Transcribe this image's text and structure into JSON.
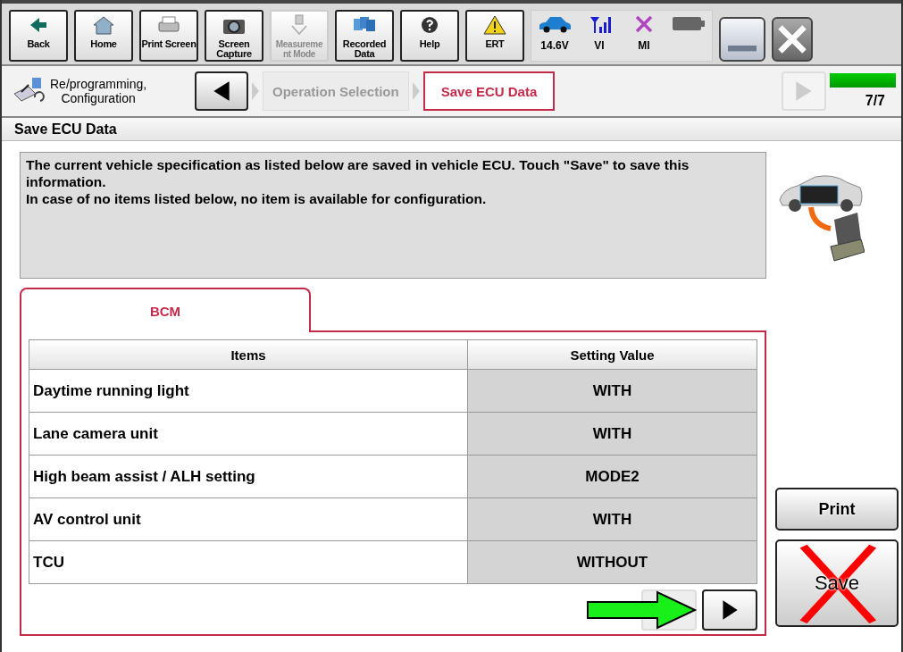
{
  "toolbar": {
    "buttons": [
      {
        "kind": "back",
        "lines": [
          "Back"
        ],
        "disabled": false
      },
      {
        "kind": "home",
        "lines": [
          "Home"
        ],
        "disabled": false
      },
      {
        "kind": "printer",
        "lines": [
          "Print Screen"
        ],
        "disabled": false
      },
      {
        "kind": "camera",
        "lines": [
          "Screen",
          "Capture"
        ],
        "disabled": false
      },
      {
        "kind": "meter",
        "lines": [
          "Measureme",
          "nt Mode"
        ],
        "disabled": true
      },
      {
        "kind": "folders",
        "lines": [
          "Recorded",
          "Data"
        ],
        "disabled": false
      },
      {
        "kind": "help",
        "lines": [
          "Help"
        ],
        "disabled": false
      },
      {
        "kind": "warning",
        "lines": [
          "ERT"
        ],
        "disabled": false
      }
    ],
    "status": [
      {
        "kind": "car",
        "label": "14.6V"
      },
      {
        "kind": "signal",
        "label": "VI"
      },
      {
        "kind": "cross",
        "label": "MI"
      },
      {
        "kind": "battery"
      }
    ]
  },
  "breadcrumb": {
    "title_lines": [
      "Re/programming,",
      "Configuration"
    ],
    "steps": [
      {
        "label": "Operation Selection",
        "selected": false
      },
      {
        "label": "Save ECU Data",
        "selected": true
      }
    ],
    "progress": {
      "level": 1,
      "label": "7/7"
    }
  },
  "section_title": "Save ECU Data",
  "info_lines": [
    "The current vehicle specification as listed below are saved in vehicle ECU. Touch \"Save\" to save this information.",
    "In case of no items listed below, no item is available for configuration."
  ],
  "tab": {
    "label": "BCM",
    "selected": true
  },
  "table": {
    "columns": [
      "Items",
      "Setting Value"
    ],
    "rows": [
      [
        "Daytime running light",
        "WITH"
      ],
      [
        "Lane camera unit",
        "WITH"
      ],
      [
        "High beam assist / ALH setting",
        "MODE2"
      ],
      [
        "AV control unit",
        "WITH"
      ],
      [
        "TCU",
        "WITHOUT"
      ]
    ]
  },
  "pager": {
    "prev_disabled": true,
    "next_disabled": false
  },
  "buttons": [
    {
      "label": "Print",
      "crossed_out": false
    },
    {
      "label": "Save",
      "crossed_out": true
    }
  ]
}
